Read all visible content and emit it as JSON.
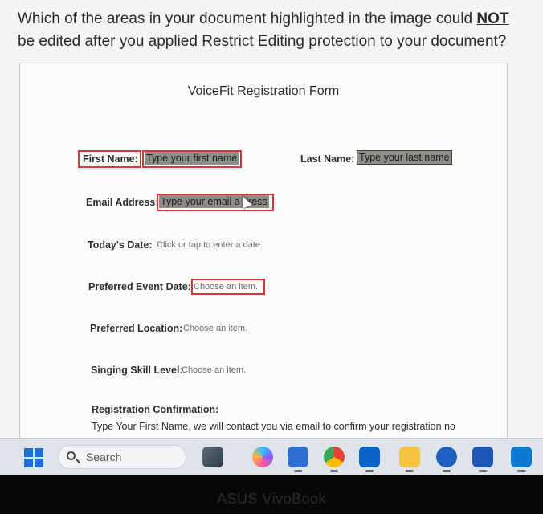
{
  "question": {
    "part1": "Which of the areas in your document highlighted in the image could ",
    "emph": "NOT",
    "part2": " be edited after you applied Restrict Editing protection to your document?"
  },
  "document": {
    "title": "VoiceFit Registration Form",
    "first_name_label": "First Name:",
    "first_name_value": "Type your first name",
    "last_name_label": "Last Name:",
    "last_name_value": "Type your last name",
    "email_label": "Email Address:",
    "email_value": "Type your email a",
    "email_value_tail": "dress",
    "todays_date_label": "Today's Date:",
    "todays_date_value": "Click or tap to enter a date.",
    "pref_event_label": "Preferred Event Date:",
    "pref_event_value": "Choose an item.",
    "pref_location_label": "Preferred Location:",
    "pref_location_value": "Choose an item.",
    "skill_label": "Singing Skill Level:",
    "skill_value": "Choose an item.",
    "confirm_label": "Registration Confirmation:",
    "confirm_text": "Type Your First Name, we will contact you via email to confirm your registration no"
  },
  "taskbar": {
    "search_label": "Search",
    "icons": [
      "start-icon",
      "search-icon",
      "media-app-icon",
      "copilot-icon",
      "store-icon",
      "chrome-icon",
      "outlook-icon",
      "file-explorer-icon",
      "remote-app-icon",
      "word-icon",
      "outlook-new-icon"
    ],
    "accent": "#1a72d8"
  },
  "device": {
    "brand": "ASUS VivoBook"
  }
}
